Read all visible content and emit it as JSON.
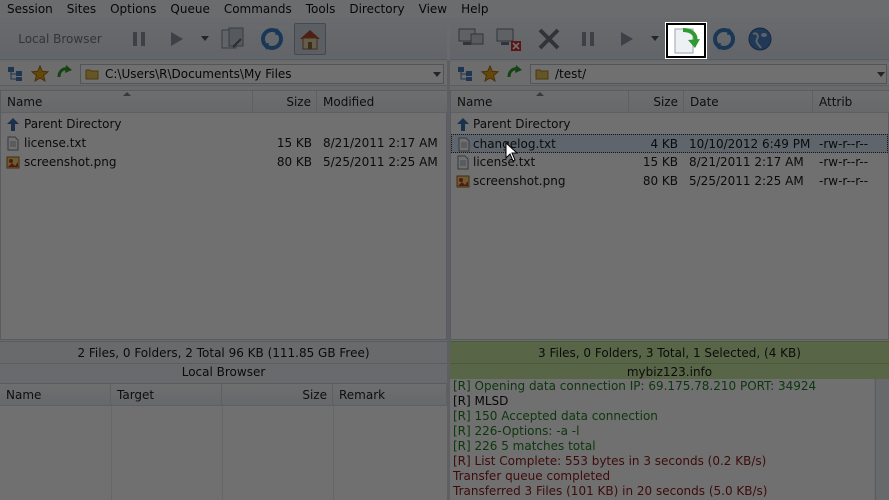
{
  "menu": [
    "Session",
    "Sites",
    "Options",
    "Queue",
    "Commands",
    "Tools",
    "Directory",
    "View",
    "Help"
  ],
  "left_toolbar": {
    "local_browser_label": "Local Browser",
    "buttons": [
      "pause-icon",
      "play-icon",
      "dropdown-arrow-icon",
      "transfer-icon",
      "refresh-icon",
      "home-icon"
    ]
  },
  "right_toolbar": {
    "buttons": [
      "connect-icon",
      "disconnect-icon",
      "abort-icon",
      "pause-icon",
      "play-icon",
      "dropdown-arrow-icon",
      "download-refresh-icon",
      "refresh-icon",
      "globe-icon"
    ]
  },
  "left_address": {
    "path": "C:\\Users\\R\\Documents\\My Files"
  },
  "right_address": {
    "path": "/test/"
  },
  "left_panel": {
    "columns": {
      "name": "Name",
      "size": "Size",
      "modified": "Modified"
    },
    "rows": [
      {
        "name": "Parent Directory",
        "size": "",
        "modified": "",
        "icon": "parent-dir-icon"
      },
      {
        "name": "license.txt",
        "size": "15 KB",
        "modified": "8/21/2011 2:17 AM",
        "icon": "text-file-icon"
      },
      {
        "name": "screenshot.png",
        "size": "80 KB",
        "modified": "5/25/2011 2:25 AM",
        "icon": "image-file-icon"
      }
    ]
  },
  "right_panel": {
    "columns": {
      "name": "Name",
      "size": "Size",
      "date": "Date",
      "attrib": "Attrib"
    },
    "rows": [
      {
        "name": "Parent Directory",
        "size": "",
        "date": "",
        "attrib": "",
        "icon": "parent-dir-icon"
      },
      {
        "name": "changelog.txt",
        "size": "4 KB",
        "date": "10/10/2012 6:49 PM",
        "attrib": "-rw-r--r--",
        "icon": "text-file-icon",
        "selected": true
      },
      {
        "name": "license.txt",
        "size": "15 KB",
        "date": "8/21/2011 2:17 AM",
        "attrib": "-rw-r--r--",
        "icon": "text-file-icon"
      },
      {
        "name": "screenshot.png",
        "size": "80 KB",
        "date": "5/25/2011 2:25 AM",
        "attrib": "-rw-r--r--",
        "icon": "image-file-icon"
      }
    ]
  },
  "left_status": {
    "summary": "2 Files, 0 Folders, 2 Total 96 KB (111.85 GB Free)",
    "title": "Local Browser"
  },
  "right_status": {
    "summary": "3 Files, 0 Folders, 3 Total, 1 Selected, (4 KB)",
    "title": "mybiz123.info"
  },
  "queue": {
    "columns": {
      "name": "Name",
      "target": "Target",
      "size": "Size",
      "remark": "Remark"
    }
  },
  "log": [
    {
      "text": "[R] Opening data connection IP: 69.175.78.210 PORT: 34924",
      "color": "green"
    },
    {
      "text": "[R] MLSD",
      "color": "black"
    },
    {
      "text": "[R] 150 Accepted data connection",
      "color": "green"
    },
    {
      "text": "[R] 226-Options: -a -l",
      "color": "green"
    },
    {
      "text": "[R] 226 5 matches total",
      "color": "green"
    },
    {
      "text": "[R] List Complete: 553 bytes in 3 seconds (0.2 KB/s)",
      "color": "red"
    },
    {
      "text": "Transfer queue completed",
      "color": "red"
    },
    {
      "text": "Transferred 3 Files (101 KB) in 20 seconds (5.0 KB/s)",
      "color": "red"
    }
  ],
  "colors": {
    "status_remote_bg": "#c9e8a1",
    "selection": "#d7e6f6",
    "log_green": "#1f7f1f",
    "log_red": "#8e1b1b"
  }
}
